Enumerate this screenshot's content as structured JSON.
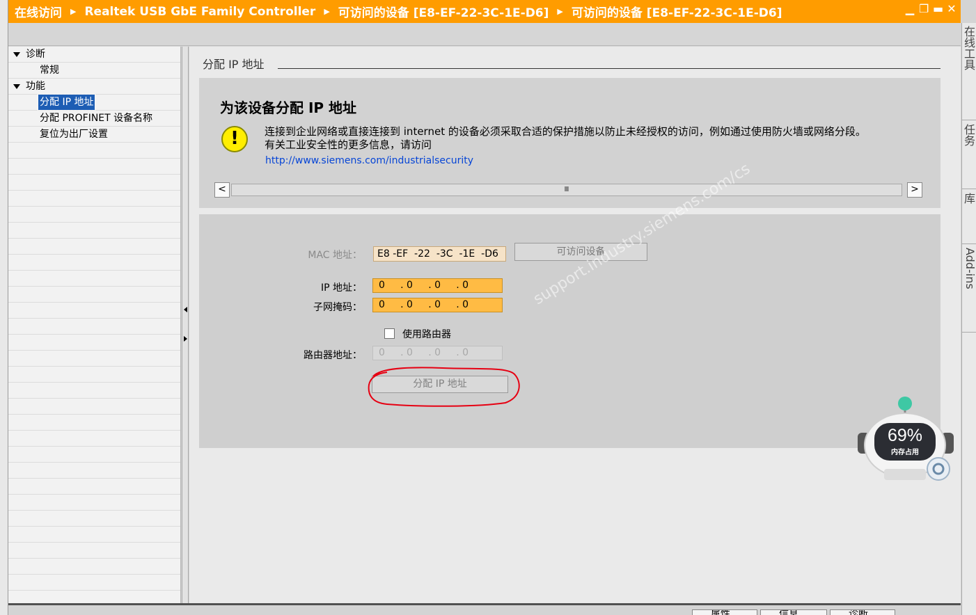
{
  "titlebar": {
    "crumbs": [
      "在线访问",
      "Realtek USB GbE Family Controller",
      "可访问的设备 [E8-EF-22-3C-1E-D6]",
      "可访问的设备 [E8-EF-22-3C-1E-D6]"
    ],
    "separator_icon": "chevron-right-icon",
    "window_controls": [
      "minimize-icon",
      "restore-icon",
      "maximize-icon",
      "close-icon"
    ]
  },
  "tree": {
    "items": [
      {
        "label": "诊断",
        "level": 0,
        "expanded": true
      },
      {
        "label": "常规",
        "level": 1
      },
      {
        "label": "功能",
        "level": 0,
        "expanded": true
      },
      {
        "label": "分配 IP 地址",
        "level": 1,
        "selected": true
      },
      {
        "label": "分配 PROFINET 设备名称",
        "level": 1
      },
      {
        "label": "复位为出厂设置",
        "level": 1
      }
    ]
  },
  "main": {
    "section_title": "分配 IP 地址",
    "info": {
      "title": "为该设备分配 IP 地址",
      "warning_icon": "warning-icon",
      "text_line1": "连接到企业网络或直接连接到 internet 的设备必须采取合适的保护措施以防止未经授权的访问，例如通过使用防火墙或网络分段。",
      "text_line2": "有关工业安全性的更多信息，请访问",
      "link": "http://www.siemens.com/industrialsecurity",
      "scroll_left": "<",
      "scroll_right": ">",
      "scroll_grip": "Ⅲ"
    },
    "form": {
      "mac_label": "MAC 地址：",
      "mac_value": "E8 -EF  -22  -3C  -1E  -D6",
      "accessible_devices_button": "可访问设备",
      "ip_label": "IP 地址：",
      "ip_value": "0     . 0     . 0     . 0",
      "subnet_label": "子网掩码：",
      "subnet_value": "0     . 0     . 0     . 0",
      "use_router_label": "使用路由器",
      "use_router_checked": false,
      "router_label": "路由器地址：",
      "router_value": "0     . 0     . 0     . 0",
      "assign_button": "分配 IP 地址"
    },
    "watermark": "support.industry.siemens.com/cs"
  },
  "rightbar": {
    "tabs": [
      "在线工具",
      "任务",
      "库",
      "Add-ins"
    ]
  },
  "bottom": {
    "tabs": [
      "属性",
      "信息",
      "诊断"
    ]
  },
  "memory_widget": {
    "percent": "69%",
    "label": "内存占用"
  },
  "colors": {
    "titlebar": "#ff9c00",
    "field_active": "#ffbb44",
    "selection": "#1d5db4",
    "link": "#0645d6"
  }
}
